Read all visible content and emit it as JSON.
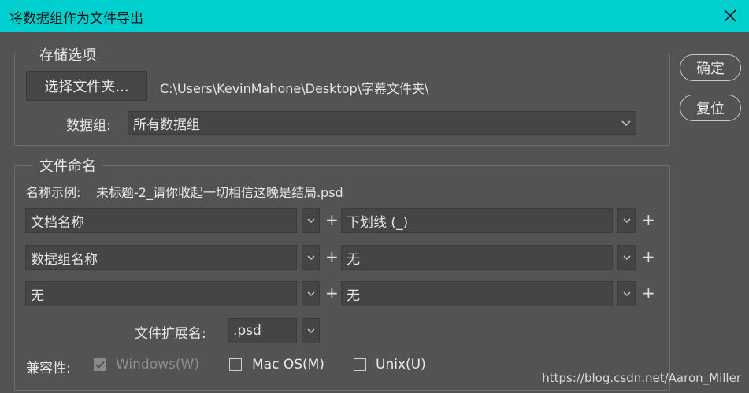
{
  "window": {
    "title": "将数据组作为文件导出"
  },
  "storage": {
    "legend": "存储选项",
    "choose_folder_button": "选择文件夹...",
    "path": "C:\\Users\\KevinMahone\\Desktop\\字幕文件夹\\",
    "dataset_label": "数据组:",
    "dataset_value": "所有数据组"
  },
  "naming": {
    "legend": "文件命名",
    "example_label": "名称示例:",
    "example_value": "未标题-2_请你收起一切相信这晚是结局.psd",
    "rows": [
      {
        "left": "文档名称",
        "right": "下划线 (_)"
      },
      {
        "left": "数据组名称",
        "right": "无"
      },
      {
        "left": "无",
        "right": "无"
      }
    ],
    "extension_label": "文件扩展名:",
    "extension_value": ".psd",
    "compat_label": "兼容性:",
    "compat": [
      {
        "label": "Windows(W)",
        "checked": true,
        "disabled": true
      },
      {
        "label": "Mac OS(M)",
        "checked": false,
        "disabled": false
      },
      {
        "label": "Unix(U)",
        "checked": false,
        "disabled": false
      }
    ],
    "plus_glyph": "+"
  },
  "actions": {
    "ok": "确定",
    "reset": "复位"
  },
  "watermark": "https://blog.csdn.net/Aaron_Miller"
}
